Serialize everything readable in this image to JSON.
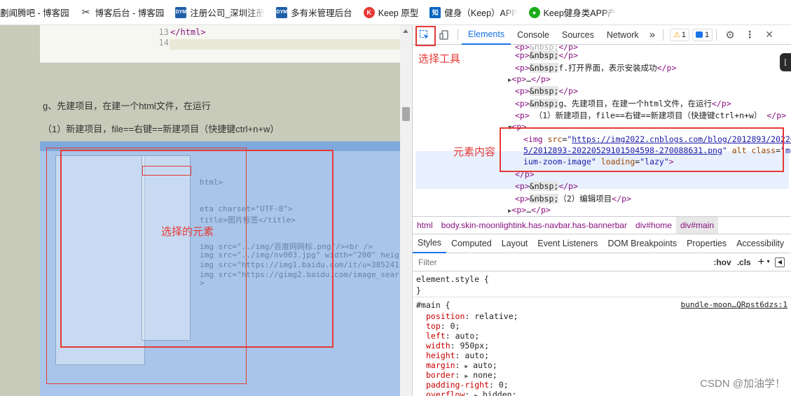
{
  "bookmarks": [
    {
      "label": "劃闻腾吧 - 博客园",
      "icon": "page-icon",
      "color": "#d93025"
    },
    {
      "label": "博客后台 - 博客园",
      "icon": "cnblogs-icon",
      "color": "#333333"
    },
    {
      "label": "注册公司_深圳注册",
      "icon": "dym-icon",
      "color": "#1f5fa8",
      "abbr": "DYM"
    },
    {
      "label": "多有米管理后台",
      "icon": "dym-icon",
      "color": "#1f5fa8",
      "abbr": "DYM"
    },
    {
      "label": "Keep 原型",
      "icon": "keep-icon",
      "color": "#e53935"
    },
    {
      "label": "健身（Keep）APP",
      "icon": "zhihu-icon",
      "color": "#0a66c2",
      "abbr": "知"
    },
    {
      "label": "Keep健身类APP产",
      "icon": "wechat-icon",
      "color": "#1aad19"
    }
  ],
  "left_page": {
    "code_lines": [
      "13",
      "14"
    ],
    "code_text": "</html>",
    "paragraph1": "g、先建项目，在建一个html文件，在运行",
    "paragraph2": "（1）新建项目，file==右键==新建项目（快捷键ctrl+n+w）",
    "embedded_code": [
      "html>",
      "eta charset=\"UTF-8\">",
      "title>图片标签</title>",
      "img src=\"../img/百度网网标.png\"/><br />",
      "img src=\"../img/nv003.jpg\" width=\"200\" heig",
      "img src=\"https://img1.baidu.com/it/u=385241",
      "img src=\"https://gimg2.baidu.com/image_searc",
      ">"
    ]
  },
  "annotations": {
    "select_tool": "选择工具",
    "element_content": "元素内容",
    "selected_element": "选择的元素"
  },
  "devtools": {
    "tabs": [
      "Elements",
      "Console",
      "Sources",
      "Network"
    ],
    "more": "»",
    "warnings": "1",
    "messages": "1",
    "dom_lines": [
      {
        "type": "p",
        "text": "&nbsp;f.打开界面，表示安装成功"
      },
      {
        "type": "p_ellipsis",
        "text": "…"
      },
      {
        "type": "p",
        "text": "&nbsp;"
      },
      {
        "type": "p",
        "text": "&nbsp;g、先建项目，在建一个html文件，在运行"
      },
      {
        "type": "p_plain",
        "text": "（1）新建项目，file==右键==新建项目（快捷键ctrl+n+w）"
      },
      {
        "type": "p_open"
      },
      {
        "type": "p",
        "text": "&nbsp;"
      },
      {
        "type": "p",
        "text": "&nbsp;（2）编辑项目"
      },
      {
        "type": "p_ellipsis",
        "text": "…"
      }
    ],
    "top_partial": "&nbsp;",
    "img_line": {
      "src": "https://img2022.cnblogs.com/blog/2012893/202205/2012893-20220529101504598-270088631.png",
      "src_part1": "https://img2022.cnblogs.com/blog/2012893/20220",
      "src_part2": "5/2012893-20220529101504598-270088631.png",
      "class_part1": "med",
      "class_part2": "ium-zoom-image",
      "loading": "lazy"
    },
    "breadcrumbs": [
      "html",
      "body.skin-moonlightink.has-navbar.has-bannerbar",
      "div#home",
      "div#main"
    ],
    "style_tabs": [
      "Styles",
      "Computed",
      "Layout",
      "Event Listeners",
      "DOM Breakpoints",
      "Properties",
      "Accessibility"
    ],
    "filter_placeholder": "Filter",
    "hov": ":hov",
    "cls": ".cls",
    "element_style": "element.style {",
    "main_rule": {
      "selector": "#main {",
      "source": "bundle-moon…QRpst6dzs:1",
      "props": [
        {
          "name": "position",
          "value": "relative;"
        },
        {
          "name": "top",
          "value": "0;"
        },
        {
          "name": "left",
          "value": "auto;"
        },
        {
          "name": "width",
          "value": "950px;"
        },
        {
          "name": "height",
          "value": "auto;"
        },
        {
          "name": "margin",
          "value": "auto;",
          "expand": true
        },
        {
          "name": "border",
          "value": "none;",
          "expand": true
        },
        {
          "name": "padding-right",
          "value": "0;"
        },
        {
          "name": "overflow",
          "value": "hidden;",
          "expand": true
        }
      ]
    }
  },
  "watermark": "CSDN @加油学！",
  "colors": {
    "accent": "#1a73e8",
    "annotation": "#e53935"
  }
}
